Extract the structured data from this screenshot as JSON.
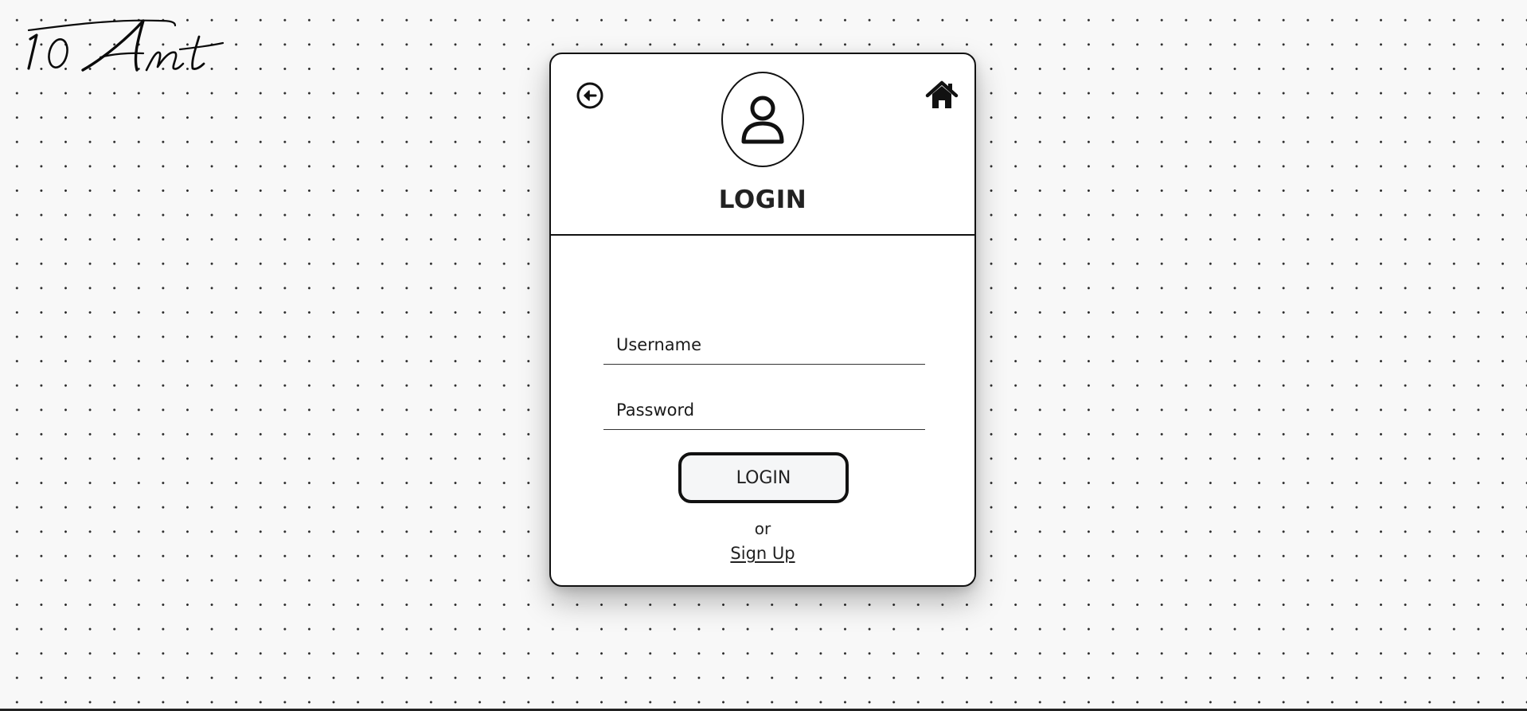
{
  "brand": {
    "logo_text": "10Ant"
  },
  "card": {
    "back_icon": "arrow-left-circle-icon",
    "home_icon": "home-icon",
    "avatar_icon": "user-icon",
    "title": "LOGIN",
    "username": {
      "placeholder": "Username",
      "value": ""
    },
    "password": {
      "placeholder": "Password",
      "value": ""
    },
    "login_button_label": "LOGIN",
    "or_text": "or",
    "signup_link_label": "Sign Up"
  },
  "colors": {
    "background": "#f8f8f8",
    "dot": "#2a2a2a",
    "card_background": "#ffffff",
    "border": "#111111",
    "button_background": "#f5f6f7"
  }
}
